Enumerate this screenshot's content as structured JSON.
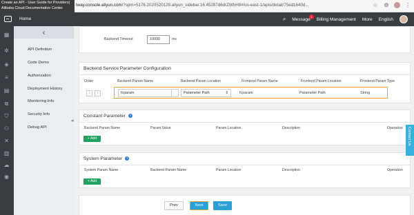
{
  "tooltip": {
    "line1": "Create an API - User Guide for Providers|",
    "line2": "Alibaba Cloud Documentation Center"
  },
  "browser": {
    "url_host": "tway.console.aliyun.com",
    "url_rest": "/?spm=5176.2020520129.aliyun_sidebar.16.45287d6drZWhH8#/us-east-1/apis/detail/75ed1640d..."
  },
  "topnav": {
    "home": "Home",
    "message": "Message",
    "message_count": "1",
    "billing": "Billing Management",
    "more": "More",
    "language": "English"
  },
  "sidebar": {
    "items": [
      {
        "label": "API Definition"
      },
      {
        "label": "Code Demo"
      },
      {
        "label": "Authorization"
      },
      {
        "label": "Deployment History"
      },
      {
        "label": "Monitoring Info"
      },
      {
        "label": "Security Info"
      },
      {
        "label": "Debug API"
      }
    ]
  },
  "backend_timeout": {
    "label": "Backend Timeout",
    "value": "10000",
    "unit": "ms"
  },
  "backend_params": {
    "title": "Backend Service Parameter Configuration",
    "headers": [
      "Order",
      "Backend Param Name",
      "Backend Param Location",
      "Frontend Param Name",
      "Frontend Param Location",
      "Frontend Param Type"
    ],
    "row": {
      "order_down": "↓",
      "order_up": "↑",
      "backend_name": "fcparam",
      "backend_location": "Parameter Path",
      "frontend_name": "fcparam",
      "frontend_location": "Parameter Path",
      "frontend_type": "String"
    }
  },
  "constant_params": {
    "title": "Constant Parameter",
    "help": "?",
    "headers": [
      "Backend Param Name",
      "Param Value",
      "Param Location",
      "Description",
      "Operation"
    ],
    "add": "+ Add"
  },
  "system_params": {
    "title": "System Parameter",
    "help": "?",
    "headers": [
      "System Param Name",
      "Backend Param Name",
      "Param Location",
      "Description",
      "Operation"
    ],
    "add": "+ Add"
  },
  "footer": {
    "prev": "Prev",
    "next": "Next",
    "save": "Save"
  },
  "contact": "Contact Us",
  "colors": {
    "topnav": "#373d41",
    "accent": "#2aa0d8",
    "add_green": "#1ea361",
    "highlight": "#f0a030"
  }
}
